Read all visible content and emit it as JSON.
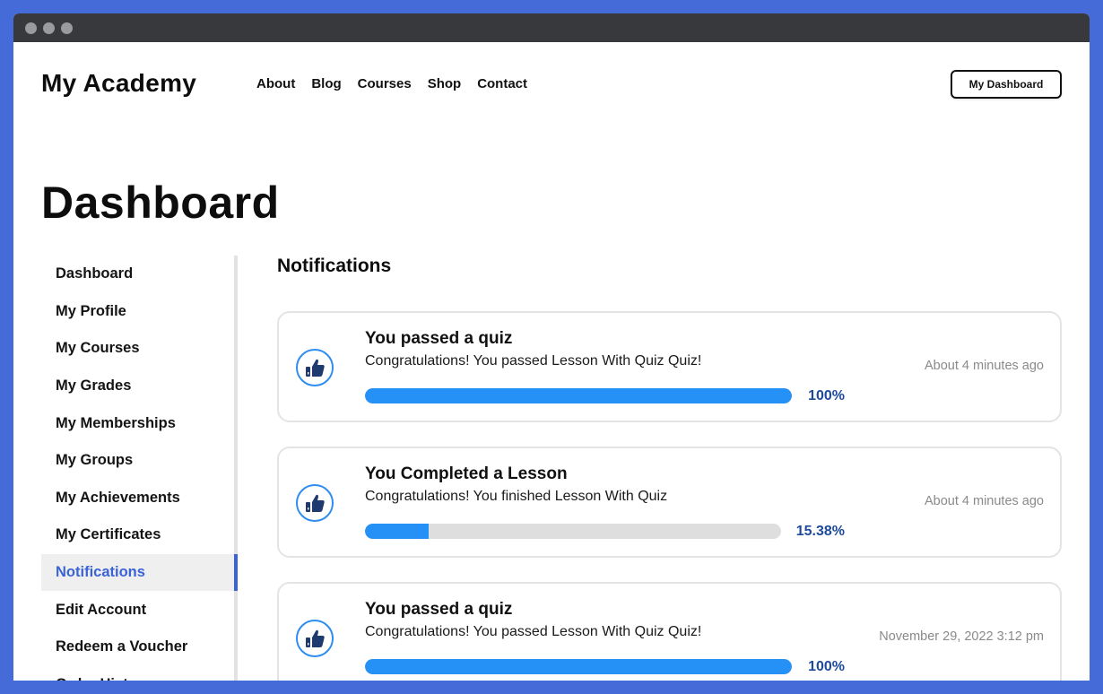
{
  "window": {
    "controls": [
      "close",
      "minimize",
      "maximize"
    ]
  },
  "header": {
    "logo": "My Academy",
    "nav": [
      "About",
      "Blog",
      "Courses",
      "Shop",
      "Contact"
    ],
    "dashboard_button": "My Dashboard"
  },
  "page": {
    "title": "Dashboard"
  },
  "sidebar": {
    "items": [
      {
        "label": "Dashboard",
        "active": false
      },
      {
        "label": "My Profile",
        "active": false
      },
      {
        "label": "My Courses",
        "active": false
      },
      {
        "label": "My Grades",
        "active": false
      },
      {
        "label": "My Memberships",
        "active": false
      },
      {
        "label": "My Groups",
        "active": false
      },
      {
        "label": "My Achievements",
        "active": false
      },
      {
        "label": "My Certificates",
        "active": false
      },
      {
        "label": "Notifications",
        "active": true
      },
      {
        "label": "Edit Account",
        "active": false
      },
      {
        "label": "Redeem a Voucher",
        "active": false
      },
      {
        "label": "Order History",
        "active": false
      }
    ]
  },
  "main": {
    "section_title": "Notifications",
    "notifications": [
      {
        "icon": "thumbs-up-icon",
        "title": "You passed a quiz",
        "message": "Congratulations! You passed Lesson With Quiz Quiz!",
        "time": "About 4 minutes ago",
        "progress_percent": 100,
        "progress_label": "100%"
      },
      {
        "icon": "thumbs-up-icon",
        "title": "You Completed a Lesson",
        "message": "Congratulations! You finished Lesson With Quiz",
        "time": "About 4 minutes ago",
        "progress_percent": 15.38,
        "progress_label": "15.38%"
      },
      {
        "icon": "thumbs-up-icon",
        "title": "You passed a quiz",
        "message": "Congratulations! You passed Lesson With Quiz Quiz!",
        "time": "November 29, 2022 3:12 pm",
        "progress_percent": 100,
        "progress_label": "100%"
      }
    ]
  },
  "colors": {
    "frame_background": "#456bd8",
    "titlebar": "#38393d",
    "accent": "#3a63d6",
    "progress_fill": "#2590f5",
    "progress_track": "#dedede",
    "progress_label": "#1d4b9a",
    "icon_ring": "#2f8df0",
    "icon_glyph": "#1e3a6e"
  }
}
